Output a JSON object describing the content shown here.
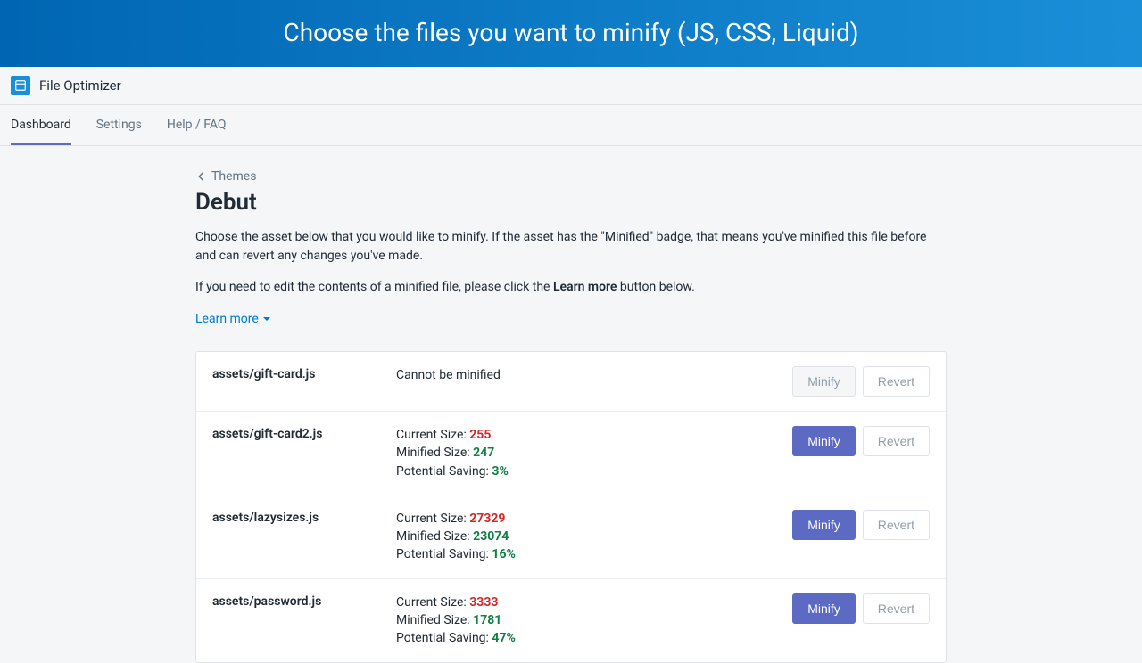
{
  "hero": "Choose the files you want to minify (JS, CSS, Liquid)",
  "app_name": "File Optimizer",
  "tabs": [
    {
      "label": "Dashboard",
      "active": true
    },
    {
      "label": "Settings",
      "active": false
    },
    {
      "label": "Help / FAQ",
      "active": false
    }
  ],
  "back_label": "Themes",
  "page_title": "Debut",
  "description1": "Choose the asset below that you would like to minify. If the asset has the \"Minified\" badge, that means you've minified this file before and can revert any changes you've made.",
  "description2_pre": "If you need to edit the contents of a minified file, please click the ",
  "description2_bold": "Learn more",
  "description2_post": " button below.",
  "learn_more": "Learn more",
  "labels": {
    "current": "Current Size: ",
    "minified": "Minified Size: ",
    "saving": "Potential Saving: ",
    "cannot": "Cannot be minified"
  },
  "buttons": {
    "minify": "Minify",
    "revert": "Revert"
  },
  "rows": [
    {
      "path": "assets/gift-card.js",
      "cannot": true
    },
    {
      "path": "assets/gift-card2.js",
      "current": "255",
      "minified": "247",
      "saving": "3%"
    },
    {
      "path": "assets/lazysizes.js",
      "current": "27329",
      "minified": "23074",
      "saving": "16%"
    },
    {
      "path": "assets/password.js",
      "current": "3333",
      "minified": "1781",
      "saving": "47%"
    }
  ]
}
